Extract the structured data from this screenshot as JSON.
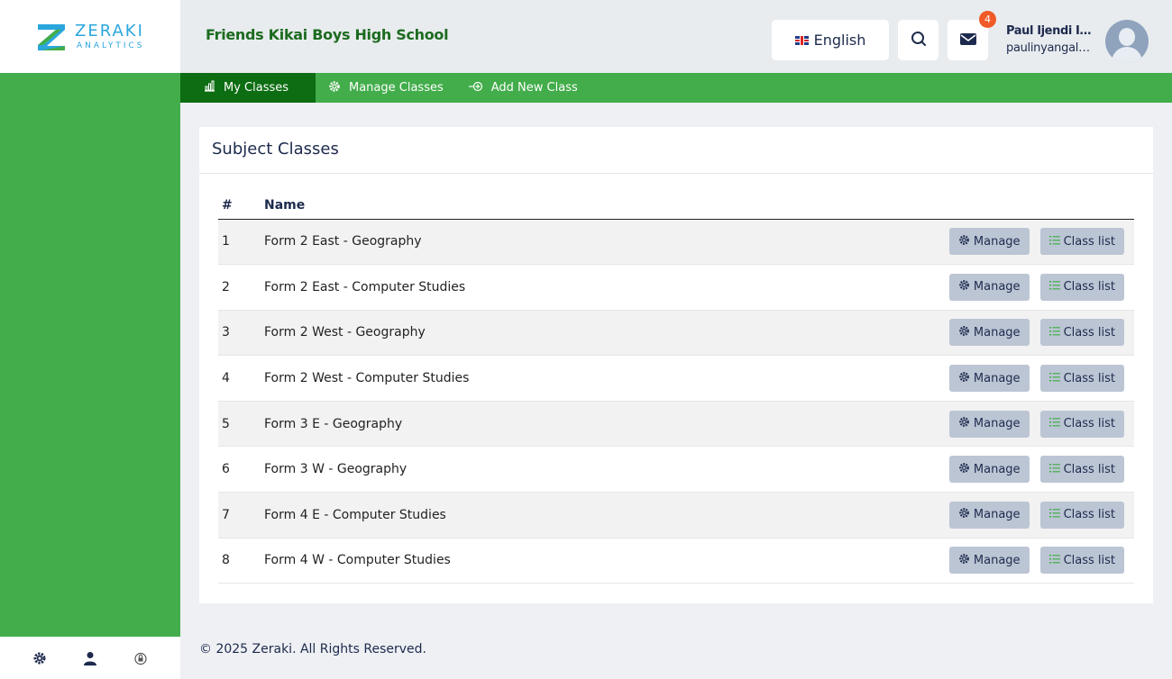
{
  "brand": {
    "name": "ZERAKI",
    "sub": "ANALYTICS"
  },
  "header": {
    "school_name": "Friends Kikai Boys High School",
    "language": "English",
    "notifications_count": "4",
    "user_name": "Paul Ijendi Inyangala",
    "user_email": "paulinyangala@gmail.com"
  },
  "nav": {
    "items": [
      {
        "label": "My Classes",
        "icon": "chart-icon",
        "active": true
      },
      {
        "label": "Manage Classes",
        "icon": "gear-icon",
        "active": false
      },
      {
        "label": "Add New Class",
        "icon": "add-circle-icon",
        "active": false
      }
    ]
  },
  "card": {
    "title": "Subject Classes",
    "columns": [
      "#",
      "Name"
    ],
    "manage_label": "Manage",
    "classlist_label": "Class list",
    "rows": [
      {
        "num": "1",
        "name": "Form 2 East - Geography"
      },
      {
        "num": "2",
        "name": "Form 2 East - Computer Studies"
      },
      {
        "num": "3",
        "name": "Form 2 West - Geography"
      },
      {
        "num": "4",
        "name": "Form 2 West - Computer Studies"
      },
      {
        "num": "5",
        "name": "Form 3 E - Geography"
      },
      {
        "num": "6",
        "name": "Form 3 W - Geography"
      },
      {
        "num": "7",
        "name": "Form 4 E - Computer Studies"
      },
      {
        "num": "8",
        "name": "Form 4 W - Computer Studies"
      }
    ]
  },
  "footer": {
    "text": "© 2025 Zeraki. All Rights Reserved."
  },
  "colors": {
    "green": "#42ad4a",
    "dark_green": "#0d6d12",
    "button": "#bcc5d4",
    "badge": "#f05a28"
  }
}
